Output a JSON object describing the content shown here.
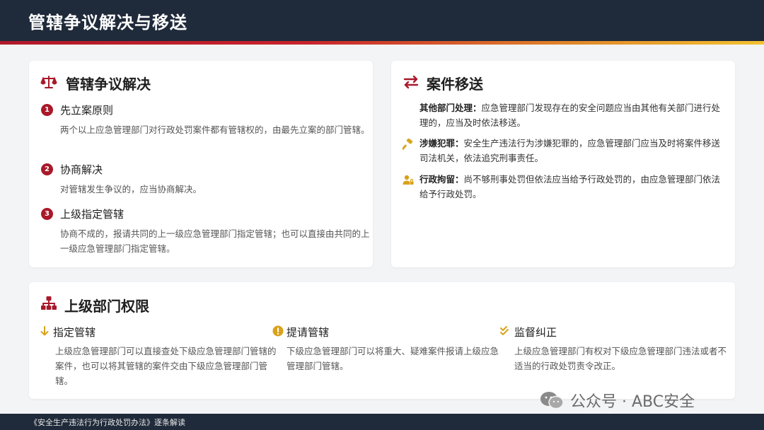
{
  "header": {
    "title": "管辖争议解决与移送"
  },
  "left": {
    "title": "管辖争议解决",
    "items": [
      {
        "num": "1",
        "title": "先立案原则",
        "desc": "两个以上应急管理部门对行政处罚案件都有管辖权的，由最先立案的部门管辖。"
      },
      {
        "num": "2",
        "title": "协商解决",
        "desc": "对管辖发生争议的，应当协商解决。"
      },
      {
        "num": "3",
        "title": "上级指定管辖",
        "desc": "协商不成的，报请共同的上一级应急管理部门指定管辖；也可以直接由共同的上一级应急管理部门指定管辖。"
      }
    ]
  },
  "right": {
    "title": "案件移送",
    "items": [
      {
        "label": "其他部门处理：",
        "text": "应急管理部门发现存在的安全问题应当由其他有关部门进行处理的，应当及时依法移送。"
      },
      {
        "label": "涉嫌犯罪：",
        "text": "安全生产违法行为涉嫌犯罪的，应急管理部门应当及时将案件移送司法机关，依法追究刑事责任。"
      },
      {
        "label": "行政拘留：",
        "text": "尚不够刑事处罚但依法应当给予行政处罚的，由应急管理部门依法给予行政处罚。"
      }
    ]
  },
  "bottom": {
    "title": "上级部门权限",
    "cols": [
      {
        "title": "指定管辖",
        "desc": "上级应急管理部门可以直接查处下级应急管理部门管辖的案件，也可以将其管辖的案件交由下级应急管理部门管辖。"
      },
      {
        "title": "提请管辖",
        "desc": "下级应急管理部门可以将重大、疑难案件报请上级应急管理部门管辖。"
      },
      {
        "title": "监督纠正",
        "desc": "上级应急管理部门有权对下级应急管理部门违法或者不适当的行政处罚责令改正。"
      }
    ]
  },
  "footer": {
    "text": "《安全生产违法行为行政处罚办法》逐条解读"
  },
  "watermark": {
    "text": "公众号 · ABC安全"
  },
  "colors": {
    "accent": "#a8192a",
    "header_bg": "#1f2a3a",
    "gold": "#d9a21b"
  },
  "icons": [
    "scale-icon",
    "transfer-arrows-icon",
    "hammer-icon",
    "user-lock-icon",
    "org-chart-icon",
    "arrow-down-icon",
    "info-circle-icon",
    "double-check-icon",
    "wechat-icon"
  ]
}
